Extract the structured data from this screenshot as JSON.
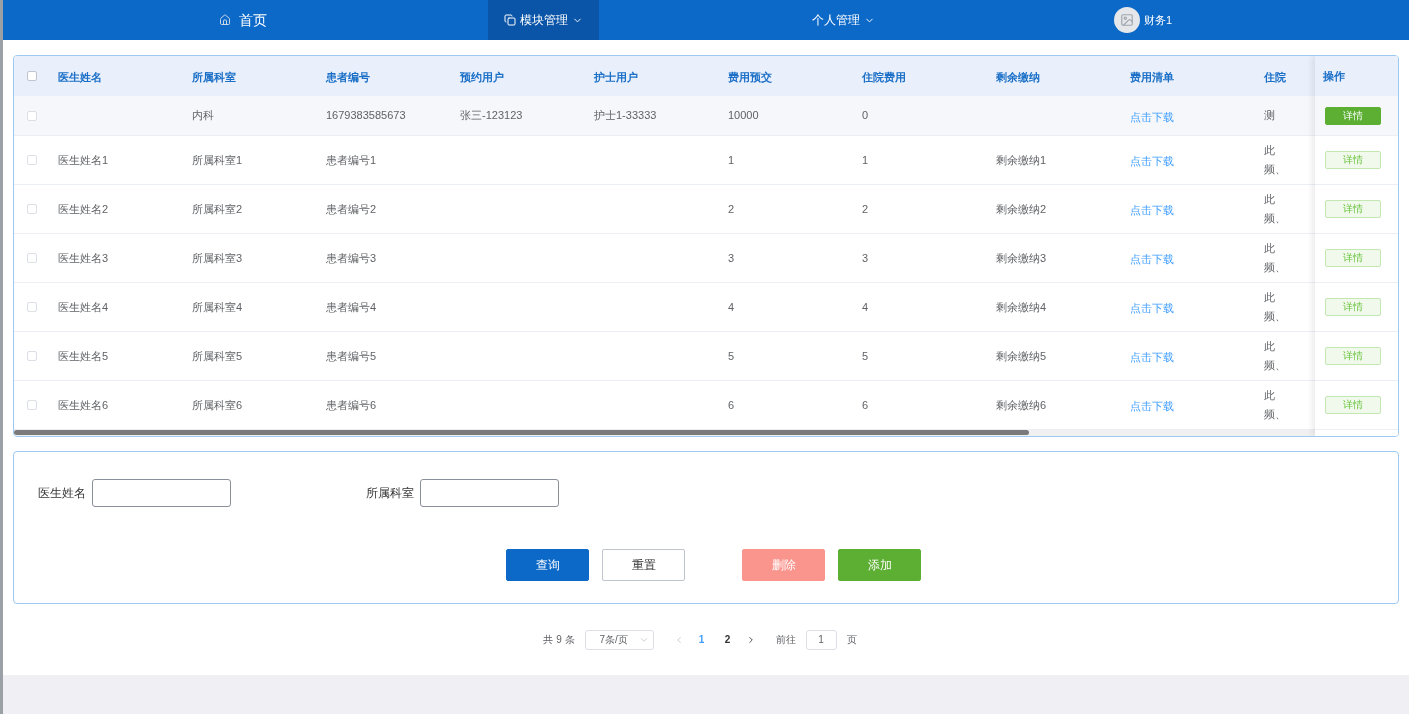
{
  "nav": {
    "items": [
      {
        "label": "首页",
        "kind": "home",
        "selected": false
      },
      {
        "label": "模块管理",
        "kind": "dropdown",
        "selected": true
      },
      {
        "label": "个人管理",
        "kind": "dropdown",
        "selected": false
      },
      {
        "label": "财务1",
        "kind": "user",
        "selected": false
      }
    ]
  },
  "table": {
    "columns": [
      "医生姓名",
      "所属科室",
      "患者编号",
      "预约用户",
      "护士用户",
      "费用预交",
      "住院费用",
      "剩余缴纳",
      "费用清单",
      "住院"
    ],
    "action_column": "操作",
    "select_all_checked": false,
    "rows": [
      {
        "hovered": true,
        "checked": false,
        "cells": [
          "",
          "内科",
          "1679383585673",
          "张三-123123",
          "护士1-33333",
          "10000",
          "0",
          "",
          "点击下载",
          "测"
        ],
        "action": "详情"
      },
      {
        "hovered": false,
        "checked": false,
        "cells": [
          "医生姓名1",
          "所属科室1",
          "患者编号1",
          "",
          "",
          "1",
          "1",
          "剩余缴纳1",
          "点击下载",
          "此频、"
        ],
        "action": "详情"
      },
      {
        "hovered": false,
        "checked": false,
        "cells": [
          "医生姓名2",
          "所属科室2",
          "患者编号2",
          "",
          "",
          "2",
          "2",
          "剩余缴纳2",
          "点击下载",
          "此频、"
        ],
        "action": "详情"
      },
      {
        "hovered": false,
        "checked": false,
        "cells": [
          "医生姓名3",
          "所属科室3",
          "患者编号3",
          "",
          "",
          "3",
          "3",
          "剩余缴纳3",
          "点击下载",
          "此频、"
        ],
        "action": "详情"
      },
      {
        "hovered": false,
        "checked": false,
        "cells": [
          "医生姓名4",
          "所属科室4",
          "患者编号4",
          "",
          "",
          "4",
          "4",
          "剩余缴纳4",
          "点击下载",
          "此频、"
        ],
        "action": "详情"
      },
      {
        "hovered": false,
        "checked": false,
        "cells": [
          "医生姓名5",
          "所属科室5",
          "患者编号5",
          "",
          "",
          "5",
          "5",
          "剩余缴纳5",
          "点击下载",
          "此频、"
        ],
        "action": "详情"
      },
      {
        "hovered": false,
        "checked": false,
        "cells": [
          "医生姓名6",
          "所属科室6",
          "患者编号6",
          "",
          "",
          "6",
          "6",
          "剩余缴纳6",
          "点击下载",
          "此频、"
        ],
        "action": "详情"
      }
    ]
  },
  "search": {
    "fields": [
      {
        "label": "医生姓名"
      },
      {
        "label": "所属科室"
      }
    ],
    "buttons": [
      {
        "label": "查询",
        "kind": "primary"
      },
      {
        "label": "重置",
        "kind": "default"
      },
      {
        "label": "删除",
        "kind": "danger"
      },
      {
        "label": "添加",
        "kind": "success"
      }
    ]
  },
  "pagination": {
    "total": "共 9 条",
    "page_size": "7条/页",
    "pages": [
      {
        "label": "1",
        "selected": true
      },
      {
        "label": "2",
        "selected": false
      }
    ],
    "goto_label": "前往",
    "goto_value": "1",
    "page_suffix": "页"
  }
}
